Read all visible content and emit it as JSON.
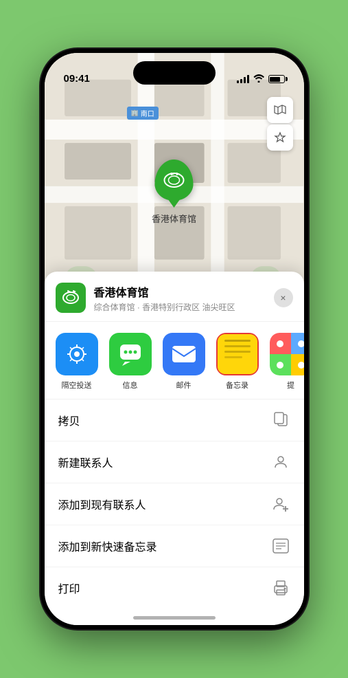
{
  "phone": {
    "time": "09:41",
    "dynamicIsland": true
  },
  "map": {
    "label": "南口",
    "stadiumName": "香港体育馆",
    "controls": {
      "map_icon": "🗺",
      "location_icon": "⬆"
    }
  },
  "bottomSheet": {
    "venueName": "香港体育馆",
    "venueSubtitle": "综合体育馆 · 香港特别行政区 油尖旺区",
    "closeLabel": "×",
    "actions": [
      {
        "id": "airdrop",
        "label": "隔空投送",
        "type": "airdrop"
      },
      {
        "id": "messages",
        "label": "信息",
        "type": "messages"
      },
      {
        "id": "mail",
        "label": "邮件",
        "type": "mail"
      },
      {
        "id": "notes",
        "label": "备忘录",
        "type": "notes"
      },
      {
        "id": "more",
        "label": "提",
        "type": "more"
      }
    ],
    "menuItems": [
      {
        "id": "copy",
        "label": "拷贝",
        "icon": "copy"
      },
      {
        "id": "new-contact",
        "label": "新建联系人",
        "icon": "person"
      },
      {
        "id": "add-existing",
        "label": "添加到现有联系人",
        "icon": "person-add"
      },
      {
        "id": "add-quick-note",
        "label": "添加到新快速备忘录",
        "icon": "note"
      },
      {
        "id": "print",
        "label": "打印",
        "icon": "print"
      }
    ]
  }
}
